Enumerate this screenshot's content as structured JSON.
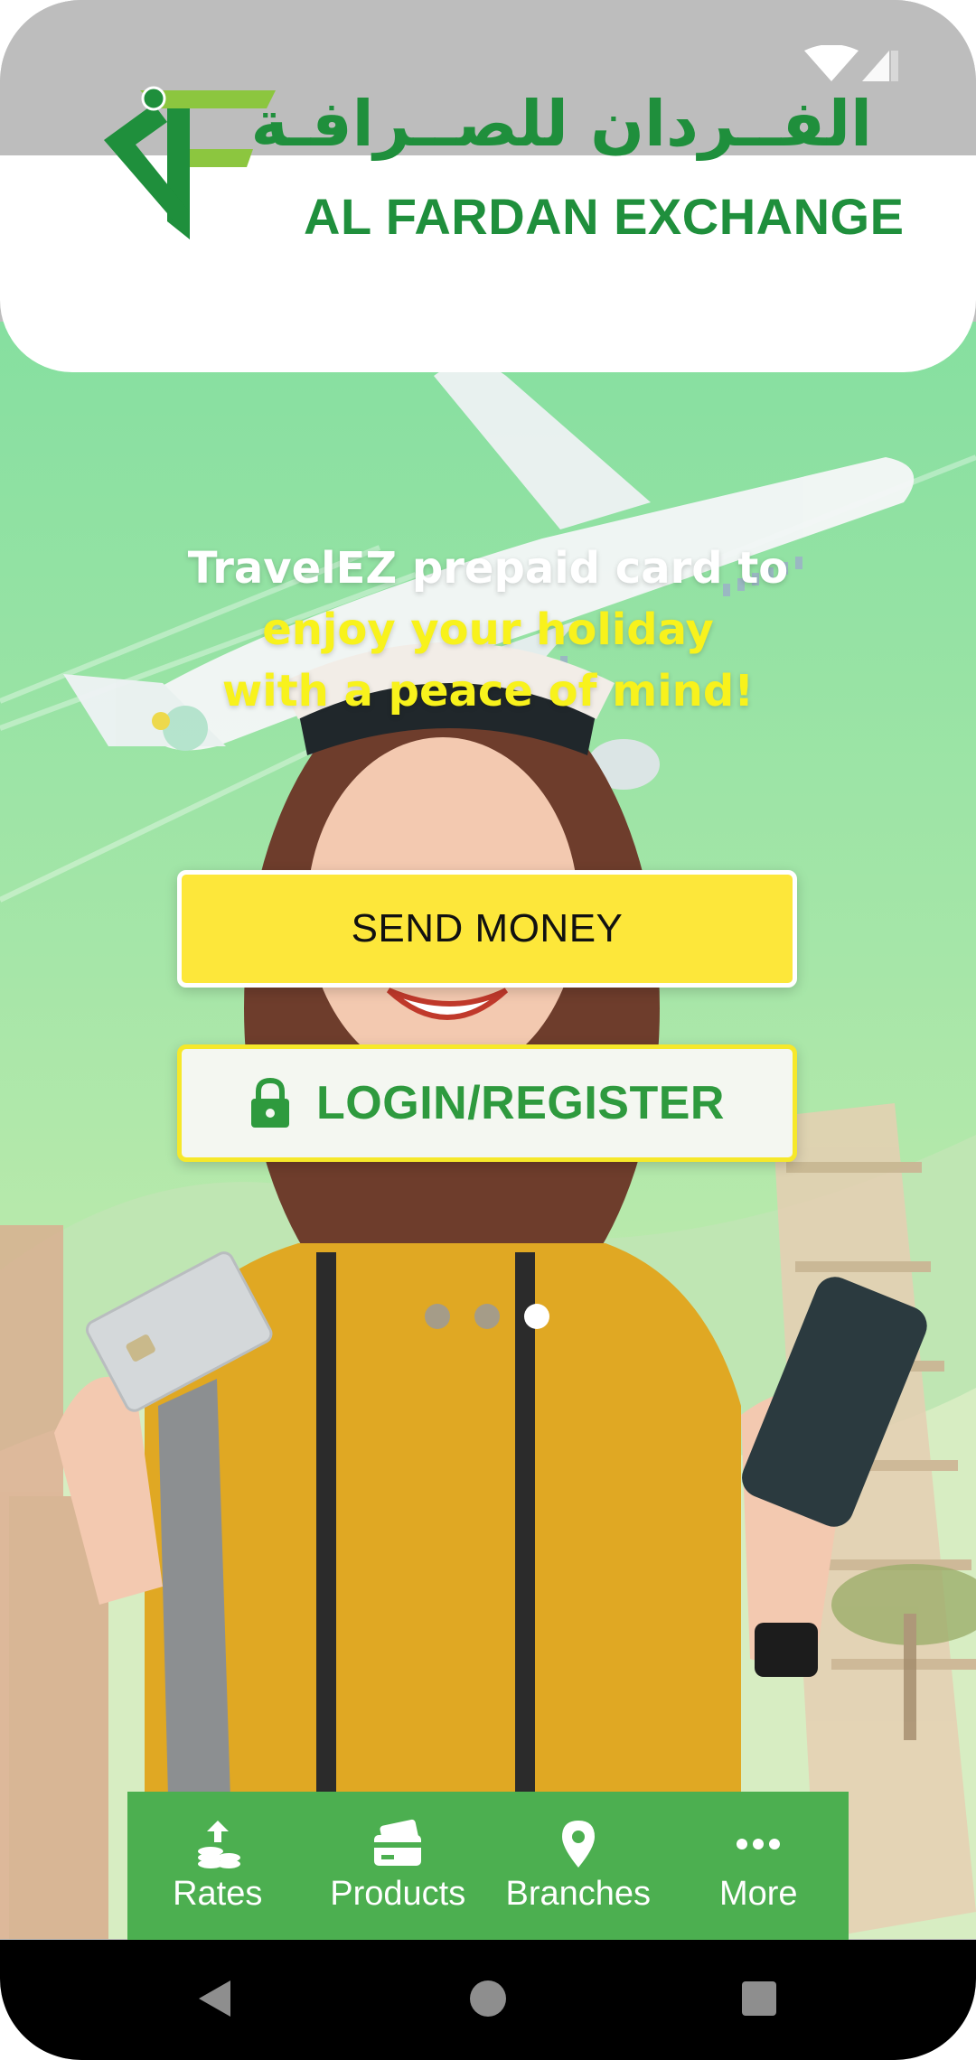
{
  "brand": {
    "arabic_name": "الفــردان للصــرافـة",
    "english_name": "AL FARDAN EXCHANGE",
    "green": "#1f8f3c",
    "yellow": "#f8f21c"
  },
  "promo": {
    "line1": "TravelEZ prepaid card to",
    "line2": "enjoy your holiday",
    "line3": "with a peace of mind!"
  },
  "actions": {
    "send_money": "SEND MONEY",
    "login_register": "LOGIN/REGISTER",
    "login_icon": "lock-icon"
  },
  "carousel": {
    "count": 3,
    "active_index": 2
  },
  "bottom_nav": {
    "items": [
      {
        "label": "Rates",
        "icon": "coins-arrow-icon"
      },
      {
        "label": "Products",
        "icon": "card-icon"
      },
      {
        "label": "Branches",
        "icon": "location-pin-icon"
      },
      {
        "label": "More",
        "icon": "more-dots-icon"
      }
    ],
    "background": "#4caf50"
  },
  "status_bar": {
    "icons": [
      "wifi-icon",
      "signal-icon"
    ]
  },
  "system_nav": {
    "buttons": [
      "back",
      "home",
      "recents"
    ]
  }
}
